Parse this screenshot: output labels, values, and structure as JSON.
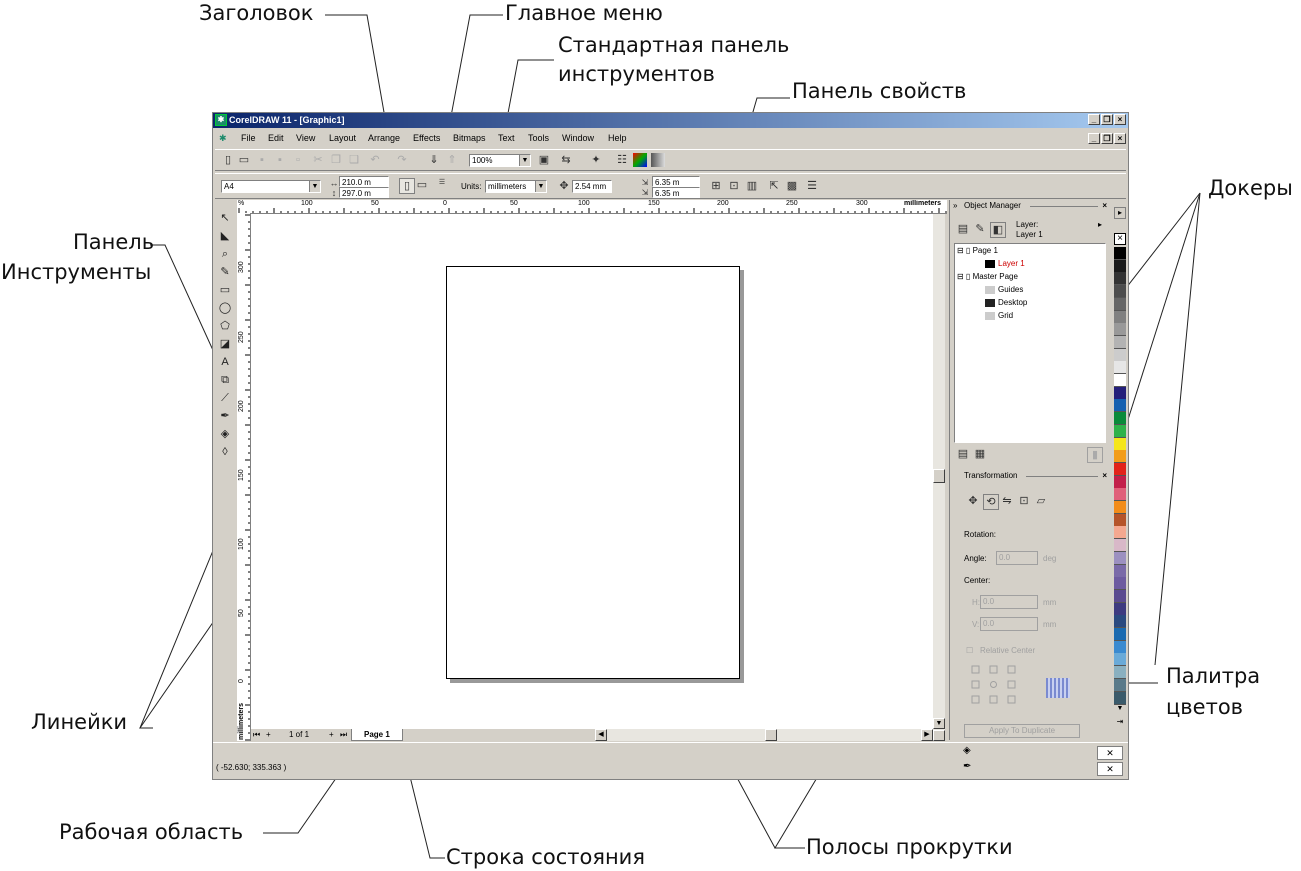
{
  "callouts": {
    "title_bar": "Заголовок",
    "main_menu": "Главное меню",
    "std_toolbar_line1": "Стандартная панель",
    "std_toolbar_line2": "инструментов",
    "property_bar": "Панель свойств",
    "dockers": "Докеры",
    "toolbox_line1": "Панель",
    "toolbox_line2": "Инструменты",
    "rulers": "Линейки",
    "palette_line1": "Палитра",
    "palette_line2": "цветов",
    "work_area": "Рабочая область",
    "status_bar": "Строка состояния",
    "scrollbars": "Полосы прокрутки"
  },
  "window": {
    "title": "CorelDRAW 11 - [Graphic1]",
    "menu": [
      "File",
      "Edit",
      "View",
      "Layout",
      "Arrange",
      "Effects",
      "Bitmaps",
      "Text",
      "Tools",
      "Window",
      "Help"
    ]
  },
  "standard_toolbar": {
    "zoom": "100%"
  },
  "property_bar": {
    "paper": "A4",
    "width": "210.0 m",
    "height": "297.0 m",
    "units_label": "Units:",
    "units": "millimeters",
    "nudge": "2.54 mm",
    "dup_x": "6.35 m",
    "dup_y": "6.35 m"
  },
  "rulers": {
    "h_labels": [
      "100",
      "50",
      "0",
      "50",
      "100",
      "150",
      "200",
      "250",
      "300"
    ],
    "h_unit": "millimeters",
    "v_labels": [
      "300",
      "250",
      "200",
      "150",
      "100",
      "50",
      "0"
    ],
    "v_unit": "millimeters",
    "corner": "%"
  },
  "page_nav": {
    "counter": "1 of 1",
    "tab": "Page 1"
  },
  "object_manager": {
    "title": "Object Manager",
    "layer_label": "Layer:",
    "layer_name": "Layer 1",
    "tree": {
      "page1": "Page 1",
      "layer1": "Layer 1",
      "master": "Master Page",
      "guides": "Guides",
      "desktop": "Desktop",
      "grid": "Grid"
    }
  },
  "transformation": {
    "title": "Transformation",
    "rotation": "Rotation:",
    "angle_label": "Angle:",
    "angle_value": "0.0",
    "angle_unit": "deg",
    "center": "Center:",
    "h_label": "H:",
    "h_value": "0.0",
    "v_label": "V:",
    "v_value": "0.0",
    "unit": "mm",
    "relative": "Relative Center",
    "apply": "Apply To Duplicate"
  },
  "palette": {
    "colors": [
      "#000000",
      "#1a1a1a",
      "#333333",
      "#4d4d4d",
      "#666666",
      "#808080",
      "#999999",
      "#b3b3b3",
      "#cccccc",
      "#e6e6e6",
      "#ffffff",
      "#241f7a",
      "#1560b0",
      "#0a8a3a",
      "#2fb24a",
      "#f5e61a",
      "#f29d1a",
      "#e2231a",
      "#c21f4a",
      "#e0607a",
      "#f28c1a",
      "#b5542a",
      "#f4a890",
      "#d8b8c8",
      "#9c90c0",
      "#7a6aa8",
      "#6d5ba0",
      "#5a4a90",
      "#3d3a80",
      "#2a4a80",
      "#1a6ab0",
      "#3a8ad0",
      "#6aaad8",
      "#8ab0c0",
      "#5a7a8a",
      "#3a5a6a"
    ]
  },
  "status": {
    "coords": "( -52.630; 335.363 )"
  }
}
